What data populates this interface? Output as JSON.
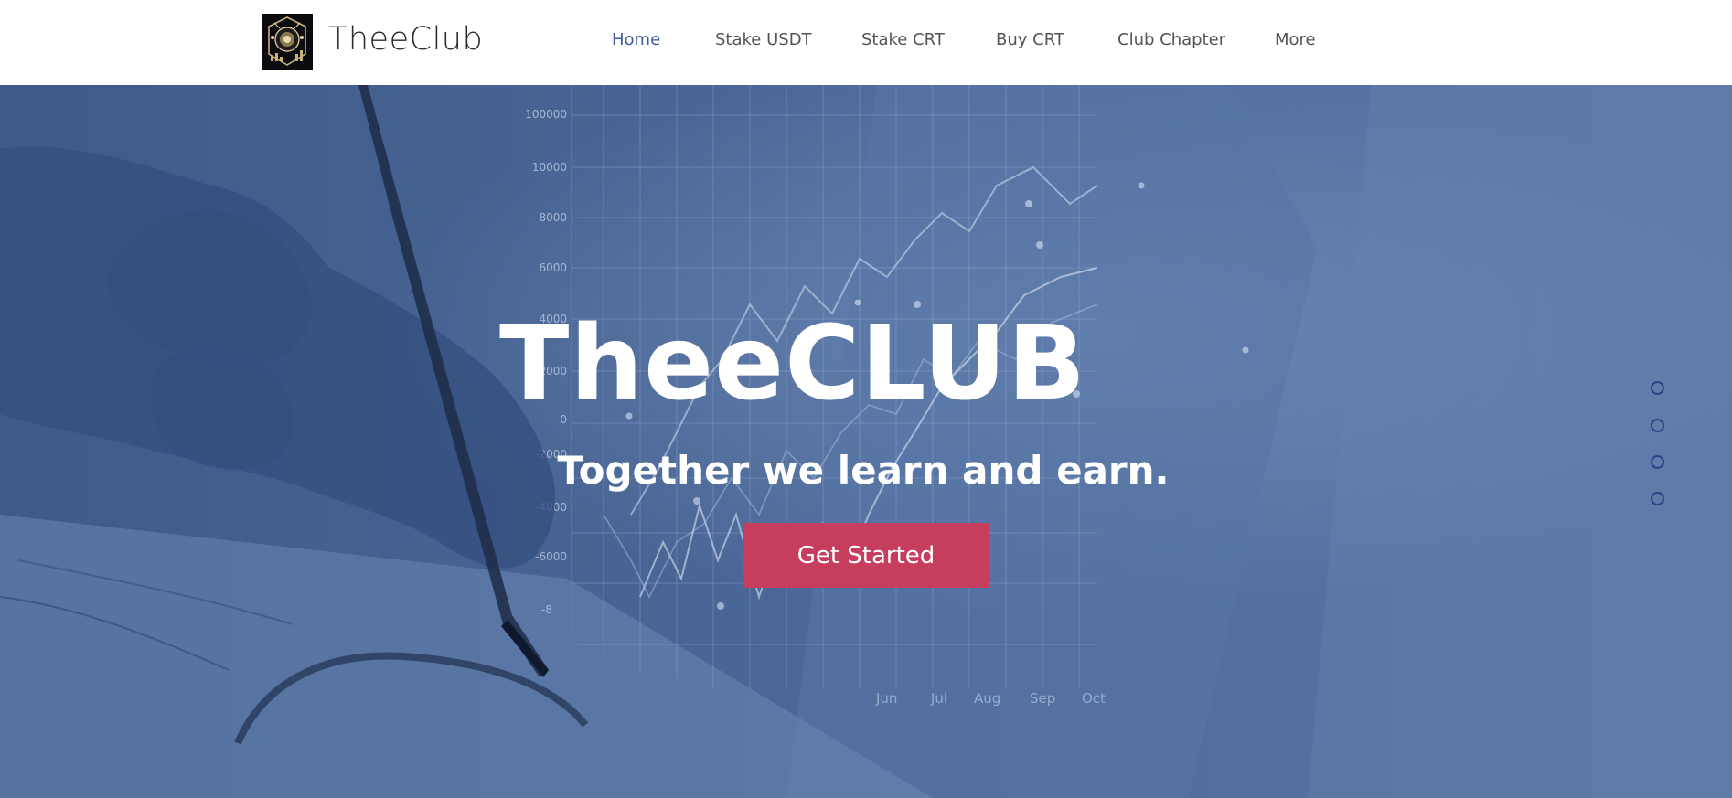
{
  "header": {
    "site_title": "TheeClub",
    "logo_icon": "theeclub-emblem"
  },
  "nav": {
    "items": [
      {
        "label": "Home",
        "active": true
      },
      {
        "label": "Stake USDT",
        "active": false
      },
      {
        "label": "Stake CRT",
        "active": false
      },
      {
        "label": "Buy CRT",
        "active": false
      },
      {
        "label": "Club Chapter",
        "active": false
      },
      {
        "label": "More",
        "active": false
      }
    ]
  },
  "hero": {
    "title": "TheeCLUB",
    "subtitle": "Together we learn and earn.",
    "cta_label": "Get Started",
    "overlay_color": "#4a6797",
    "background_chart": {
      "y_ticks": [
        "100000",
        "10000",
        "8000",
        "6000",
        "4000",
        "2000",
        "0",
        "-2000",
        "-4000",
        "-6000",
        "-8"
      ],
      "x_ticks": [
        "Jun",
        "Jul",
        "Aug",
        "Sep",
        "Oct"
      ]
    }
  },
  "section_nav": {
    "dots": [
      {
        "active": false
      },
      {
        "active": false
      },
      {
        "active": false
      },
      {
        "active": false
      }
    ]
  },
  "colors": {
    "nav_active": "#3e5b9e",
    "nav_text": "#555555",
    "cta_bg": "#c63d5d",
    "dot_ring": "#2c3f87"
  }
}
